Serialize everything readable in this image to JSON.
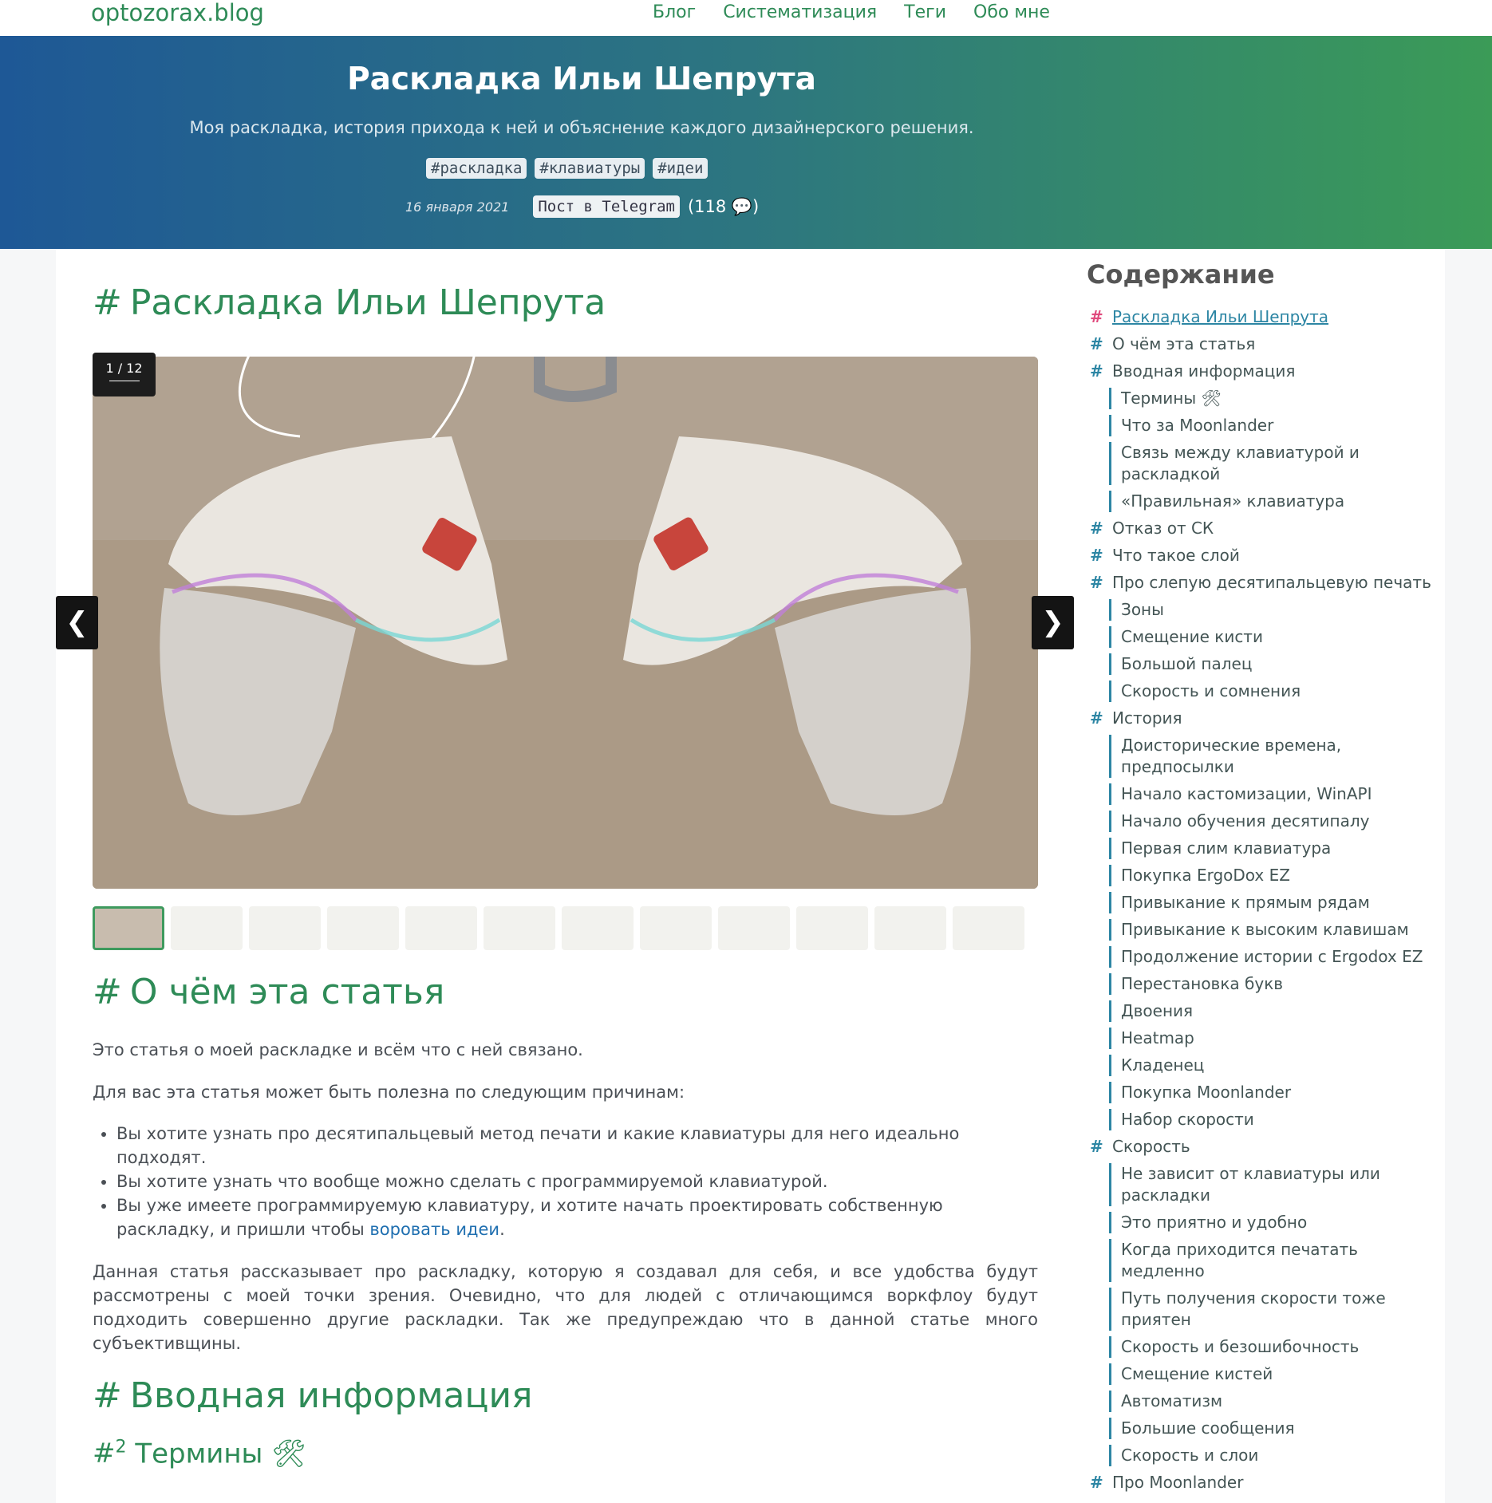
{
  "nav": {
    "site_name": "optozorax.blog",
    "links": [
      "Блог",
      "Систематизация",
      "Теги",
      "Обо мне"
    ]
  },
  "hero": {
    "title": "Раскладка Ильи Шепрута",
    "subtitle": "Моя раскладка, история прихода к ней и объяснение каждого дизайнерского решения.",
    "tags": [
      "#раскладка",
      "#клавиатуры",
      "#идеи"
    ],
    "date": "16 января 2021",
    "telegram_label": "Пост в Telegram",
    "comments": "(118 💬)"
  },
  "article": {
    "h1_hash": "#",
    "title": "Раскладка Ильи Шепрута",
    "gallery": {
      "counter": "1 / 12",
      "prev": "❮",
      "next": "❯",
      "thumb_count": 12
    },
    "section_about": "О чём эта статья",
    "p1": "Это статья о моей раскладке и всём что с ней связано.",
    "p2": "Для вас эта статья может быть полезна по следующим причинам:",
    "bullets": [
      "Вы хотите узнать про десятипальцевый метод печати и какие клавиатуры для него идеально подходят.",
      "Вы хотите узнать что вообще можно сделать с программируемой клавиатурой.",
      "Вы уже имеете программируемую клавиатуру, и хотите начать проектировать собственную раскладку, и пришли чтобы "
    ],
    "bullet_link": "воровать идеи",
    "bullet_link_tail": ".",
    "p3": "Данная статья рассказывает про раскладку, которую я создавал для себя, и все удобства будут рассмотрены с моей точки зрения. Очевидно, что для людей с отличающимся воркфлоу будут подходить совершенно другие раскладки. Так же предупреждаю что в данной статье много субъективщины.",
    "section_intro": "Вводная информация",
    "h2_sup": "2",
    "section_terms": "Термины 🛠"
  },
  "toc": {
    "title": "Содержание",
    "hash": "#",
    "items": [
      {
        "label": "Раскладка Ильи Шепрута",
        "level": 1
      },
      {
        "label": "О чём эта статья",
        "level": 1
      },
      {
        "label": "Вводная информация",
        "level": 1
      },
      {
        "label": "Термины 🛠",
        "level": 2
      },
      {
        "label": "Что за Moonlander",
        "level": 2
      },
      {
        "label": "Связь между клавиатурой и раскладкой",
        "level": 2
      },
      {
        "label": "«Правильная» клавиатура",
        "level": 2
      },
      {
        "label": "Отказ от СК",
        "level": 1
      },
      {
        "label": "Что такое слой",
        "level": 1
      },
      {
        "label": "Про слепую десятипальцевую печать",
        "level": 1
      },
      {
        "label": "Зоны",
        "level": 2
      },
      {
        "label": "Смещение кисти",
        "level": 2
      },
      {
        "label": "Большой палец",
        "level": 2
      },
      {
        "label": "Скорость и сомнения",
        "level": 2
      },
      {
        "label": "История",
        "level": 1
      },
      {
        "label": "Доисторические времена, предпосылки",
        "level": 2
      },
      {
        "label": "Начало кастомизации, WinAPI",
        "level": 2
      },
      {
        "label": "Начало обучения десятипалу",
        "level": 2
      },
      {
        "label": "Первая слим клавиатура",
        "level": 2
      },
      {
        "label": "Покупка ErgoDox EZ",
        "level": 2
      },
      {
        "label": "Привыкание к прямым рядам",
        "level": 2
      },
      {
        "label": "Привыкание к высоким клавишам",
        "level": 2
      },
      {
        "label": "Продолжение истории с Ergodox EZ",
        "level": 2
      },
      {
        "label": "Перестановка букв",
        "level": 2
      },
      {
        "label": "Двоения",
        "level": 2
      },
      {
        "label": "Heatmap",
        "level": 2
      },
      {
        "label": "Кладенец",
        "level": 2
      },
      {
        "label": "Покупка Moonlander",
        "level": 2
      },
      {
        "label": "Набор скорости",
        "level": 2
      },
      {
        "label": "Скорость",
        "level": 1
      },
      {
        "label": "Не зависит от клавиатуры или раскладки",
        "level": 2
      },
      {
        "label": "Это приятно и удобно",
        "level": 2
      },
      {
        "label": "Когда приходится печатать медленно",
        "level": 2
      },
      {
        "label": "Путь получения скорости тоже приятен",
        "level": 2
      },
      {
        "label": "Скорость и безошибочность",
        "level": 2
      },
      {
        "label": "Смещение кистей",
        "level": 2
      },
      {
        "label": "Автоматизм",
        "level": 2
      },
      {
        "label": "Большие сообщения",
        "level": 2
      },
      {
        "label": "Скорость и слои",
        "level": 2
      },
      {
        "label": "Про Moonlander",
        "level": 1
      }
    ]
  }
}
